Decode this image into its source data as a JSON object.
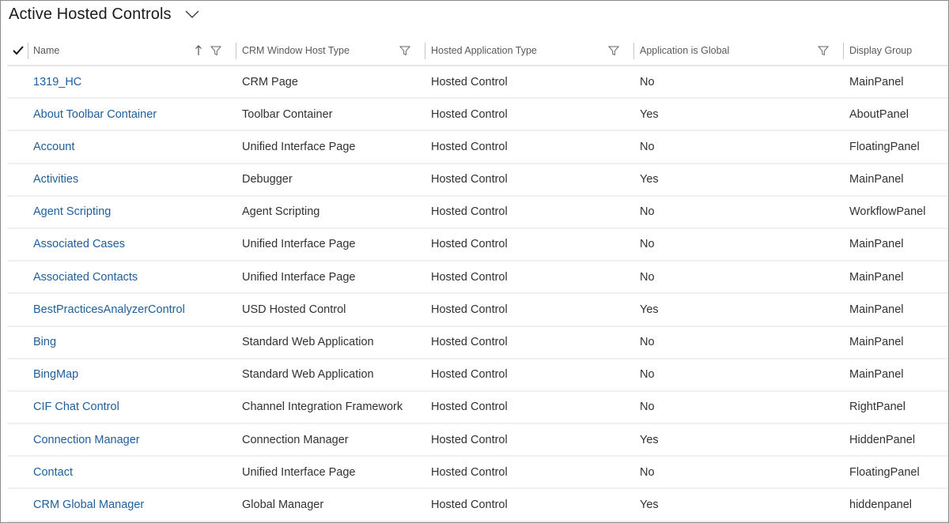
{
  "view": {
    "title": "Active Hosted Controls",
    "chevron_icon": "chevron-down-icon"
  },
  "columns": [
    {
      "label": "Name",
      "sort": "ascending",
      "sort_icon": "arrow-up-icon",
      "filter_icon": "filter-icon"
    },
    {
      "label": "CRM Window Host Type",
      "filter_icon": "filter-icon"
    },
    {
      "label": "Hosted Application Type",
      "filter_icon": "filter-icon"
    },
    {
      "label": "Application is Global",
      "filter_icon": "filter-icon"
    },
    {
      "label": "Display Group"
    }
  ],
  "select_all_icon": "checkmark-icon",
  "rows": [
    {
      "name": "1319_HC",
      "host_type": "CRM Page",
      "app_type": "Hosted Control",
      "is_global": "No",
      "display_group": "MainPanel"
    },
    {
      "name": "About Toolbar Container",
      "host_type": "Toolbar Container",
      "app_type": "Hosted Control",
      "is_global": "Yes",
      "display_group": "AboutPanel"
    },
    {
      "name": "Account",
      "host_type": "Unified Interface Page",
      "app_type": "Hosted Control",
      "is_global": "No",
      "display_group": "FloatingPanel"
    },
    {
      "name": "Activities",
      "host_type": "Debugger",
      "app_type": "Hosted Control",
      "is_global": "Yes",
      "display_group": "MainPanel"
    },
    {
      "name": "Agent Scripting",
      "host_type": "Agent Scripting",
      "app_type": "Hosted Control",
      "is_global": "No",
      "display_group": "WorkflowPanel"
    },
    {
      "name": "Associated Cases",
      "host_type": "Unified Interface Page",
      "app_type": "Hosted Control",
      "is_global": "No",
      "display_group": "MainPanel"
    },
    {
      "name": "Associated Contacts",
      "host_type": "Unified Interface Page",
      "app_type": "Hosted Control",
      "is_global": "No",
      "display_group": "MainPanel"
    },
    {
      "name": "BestPracticesAnalyzerControl",
      "host_type": "USD Hosted Control",
      "app_type": "Hosted Control",
      "is_global": "Yes",
      "display_group": "MainPanel"
    },
    {
      "name": "Bing",
      "host_type": "Standard Web Application",
      "app_type": "Hosted Control",
      "is_global": "No",
      "display_group": "MainPanel"
    },
    {
      "name": "BingMap",
      "host_type": "Standard Web Application",
      "app_type": "Hosted Control",
      "is_global": "No",
      "display_group": "MainPanel"
    },
    {
      "name": "CIF Chat Control",
      "host_type": "Channel Integration Framework",
      "app_type": "Hosted Control",
      "is_global": "No",
      "display_group": "RightPanel"
    },
    {
      "name": "Connection Manager",
      "host_type": "Connection Manager",
      "app_type": "Hosted Control",
      "is_global": "Yes",
      "display_group": "HiddenPanel"
    },
    {
      "name": "Contact",
      "host_type": "Unified Interface Page",
      "app_type": "Hosted Control",
      "is_global": "No",
      "display_group": "FloatingPanel"
    },
    {
      "name": "CRM Global Manager",
      "host_type": "Global Manager",
      "app_type": "Hosted Control",
      "is_global": "Yes",
      "display_group": "hiddenpanel"
    }
  ]
}
